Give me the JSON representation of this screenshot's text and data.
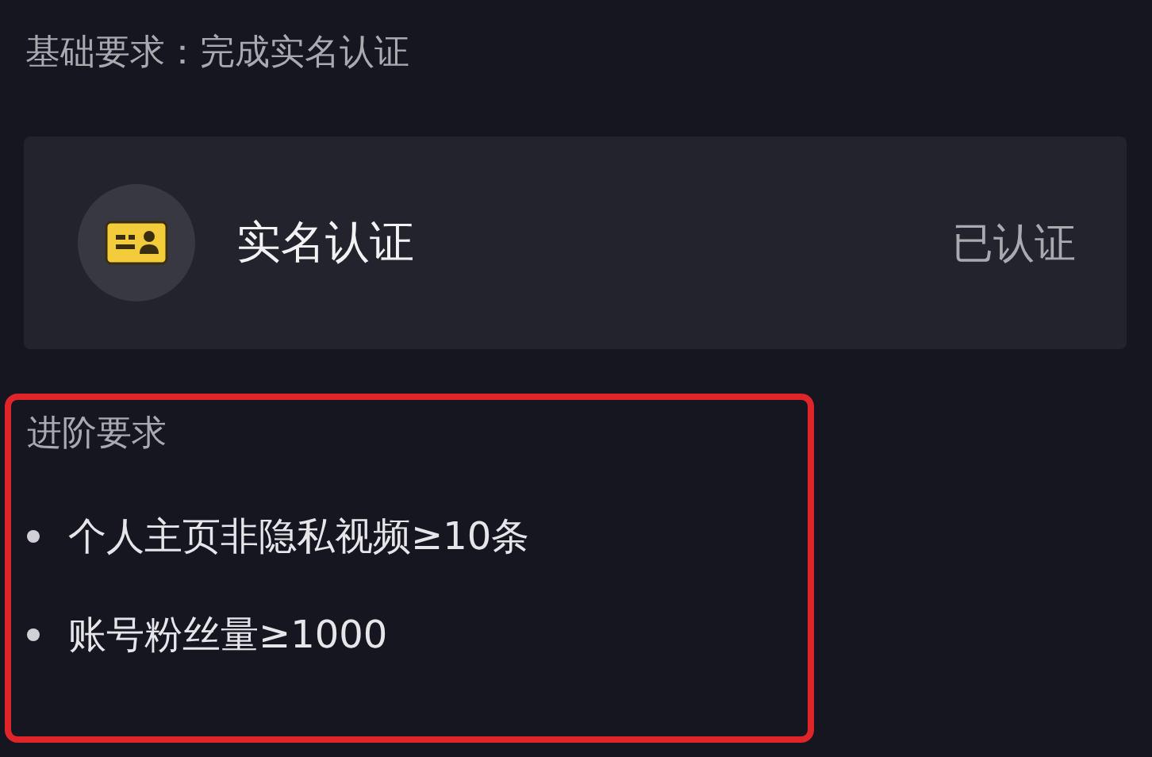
{
  "basic_requirement": "基础要求：完成实名认证",
  "verification_card": {
    "title": "实名认证",
    "status": "已认证"
  },
  "advanced_section": {
    "highlighted": true,
    "title": "进阶要求",
    "items": [
      "个人主页非隐私视频≥10条",
      "账号粉丝量≥1000"
    ]
  }
}
